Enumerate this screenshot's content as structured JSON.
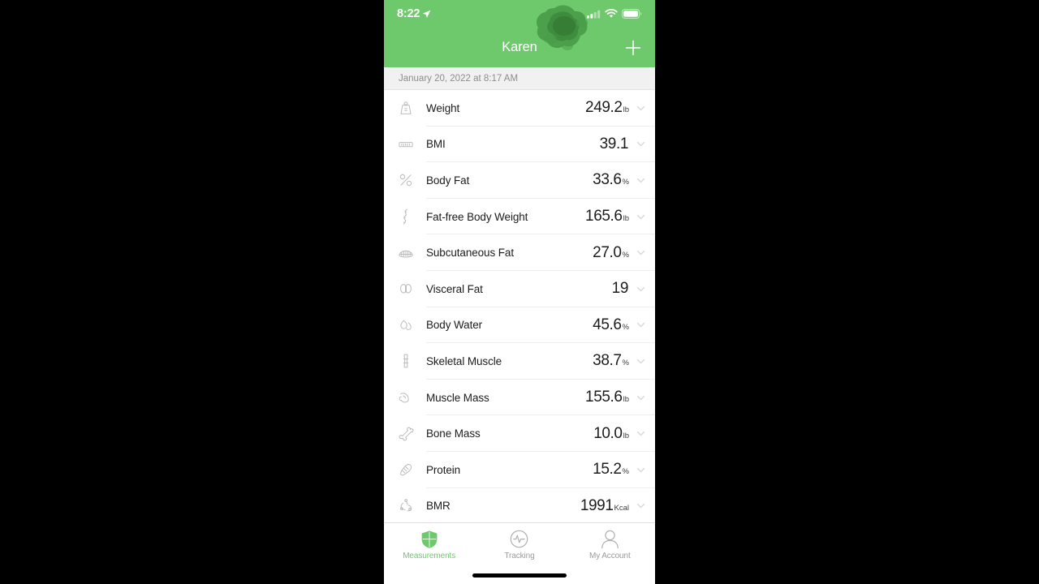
{
  "statusbar": {
    "time": "8:22",
    "location_icon": "location-arrow-icon",
    "cellular_icon": "cellular-signal-icon",
    "wifi_icon": "wifi-icon",
    "battery_icon": "battery-icon"
  },
  "header": {
    "title": "Karen",
    "add_icon": "plus-icon",
    "accent_color": "#6ec96c",
    "redaction": "redaction-blob"
  },
  "section": {
    "date_label": "January 20, 2022 at 8:17 AM"
  },
  "measurements": [
    {
      "icon": "weight-scale-icon",
      "label": "Weight",
      "value": "249.2",
      "unit": "lb",
      "chevron": "chevron-down-icon"
    },
    {
      "icon": "ruler-icon",
      "label": "BMI",
      "value": "39.1",
      "unit": "",
      "chevron": "chevron-down-icon"
    },
    {
      "icon": "percent-icon",
      "label": "Body Fat",
      "value": "33.6",
      "unit": "%",
      "chevron": "chevron-down-icon"
    },
    {
      "icon": "body-outline-icon",
      "label": "Fat-free Body Weight",
      "value": "165.6",
      "unit": "lb",
      "chevron": "chevron-down-icon"
    },
    {
      "icon": "fat-layer-icon",
      "label": "Subcutaneous Fat",
      "value": "27.0",
      "unit": "%",
      "chevron": "chevron-down-icon"
    },
    {
      "icon": "organs-icon",
      "label": "Visceral Fat",
      "value": "19",
      "unit": "",
      "chevron": "chevron-down-icon"
    },
    {
      "icon": "water-drop-icon",
      "label": "Body Water",
      "value": "45.6",
      "unit": "%",
      "chevron": "chevron-down-icon"
    },
    {
      "icon": "bone-joint-icon",
      "label": "Skeletal Muscle",
      "value": "38.7",
      "unit": "%",
      "chevron": "chevron-down-icon"
    },
    {
      "icon": "flexed-bicep-icon",
      "label": "Muscle Mass",
      "value": "155.6",
      "unit": "lb",
      "chevron": "chevron-down-icon"
    },
    {
      "icon": "bone-icon",
      "label": "Bone Mass",
      "value": "10.0",
      "unit": "lb",
      "chevron": "chevron-down-icon"
    },
    {
      "icon": "protein-molecule-icon",
      "label": "Protein",
      "value": "15.2",
      "unit": "%",
      "chevron": "chevron-down-icon"
    },
    {
      "icon": "metabolism-icon",
      "label": "BMR",
      "value": "1991",
      "unit": "Kcal",
      "chevron": "chevron-down-icon"
    }
  ],
  "tabbar": {
    "items": [
      {
        "icon": "shield-icon",
        "label": "Measurements",
        "active": true
      },
      {
        "icon": "pulse-circle-icon",
        "label": "Tracking",
        "active": false
      },
      {
        "icon": "person-icon",
        "label": "My Account",
        "active": false
      }
    ],
    "active_color": "#6ec96c",
    "inactive_color": "#9a9a9c"
  }
}
